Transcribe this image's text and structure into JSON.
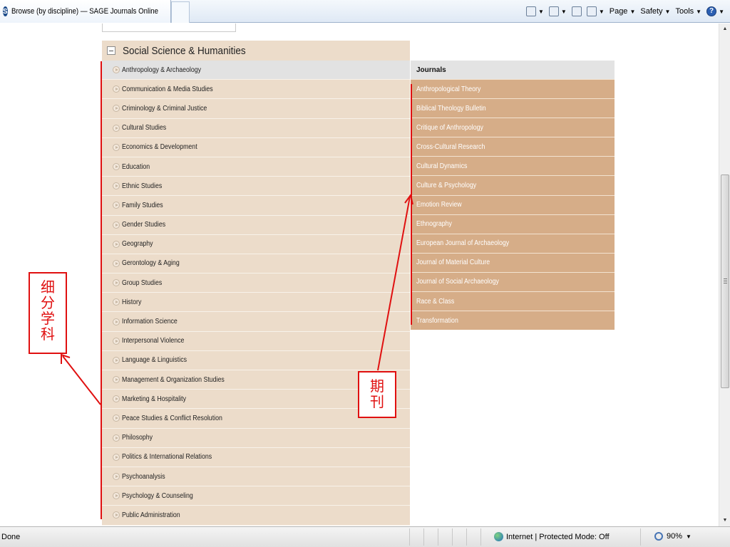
{
  "browser": {
    "tab_title": "Browse (by discipline) — SAGE Journals Online",
    "tab_icon": "S",
    "commands": {
      "page": "Page",
      "safety": "Safety",
      "tools": "Tools",
      "help": "?"
    }
  },
  "content": {
    "category": "Social Science & Humanities",
    "disciplines": [
      "Anthropology & Archaeology",
      "Communication & Media Studies",
      "Criminology & Criminal Justice",
      "Cultural Studies",
      "Economics & Development",
      "Education",
      "Ethnic Studies",
      "Family Studies",
      "Gender Studies",
      "Geography",
      "Gerontology & Aging",
      "Group Studies",
      "History",
      "Information Science",
      "Interpersonal Violence",
      "Language & Linguistics",
      "Management & Organization Studies",
      "Marketing & Hospitality",
      "Peace Studies & Conflict Resolution",
      "Philosophy",
      "Politics & International Relations",
      "Psychoanalysis",
      "Psychology & Counseling",
      "Public Administration"
    ],
    "journals_header": "Journals",
    "journals": [
      "Anthropological Theory",
      "Biblical Theology Bulletin",
      "Critique of Anthropology",
      "Cross-Cultural Research",
      "Cultural Dynamics",
      "Culture & Psychology",
      "Emotion Review",
      "Ethnography",
      "European Journal of Archaeology",
      "Journal of Material Culture",
      "Journal of Social Archaeology",
      "Race & Class",
      "Transformation"
    ]
  },
  "annotations": {
    "subdiscipline": "细分学科",
    "journals": "期刊",
    "color": "#e01010"
  },
  "statusbar": {
    "status": "Done",
    "zone": "Internet | Protected Mode: Off",
    "zoom": "90%"
  }
}
